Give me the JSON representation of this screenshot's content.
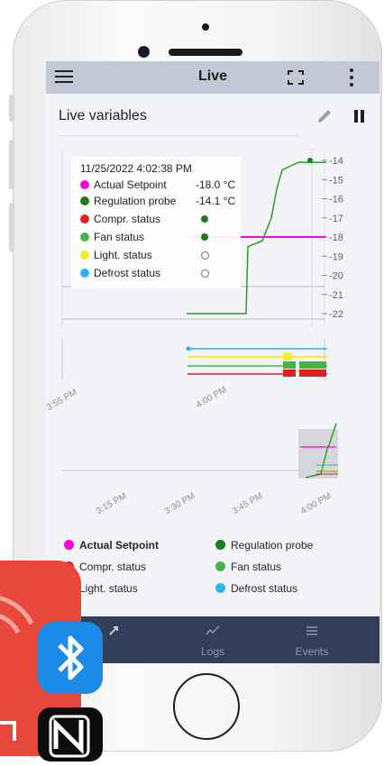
{
  "app": {
    "title": "Live",
    "section_title": "Live variables"
  },
  "tooltip": {
    "time": "11/25/2022 4:02:38 PM",
    "rows": [
      {
        "label": "Actual Setpoint",
        "value": "-18.0 °C",
        "color": "#ff00e0"
      },
      {
        "label": "Regulation probe",
        "value": "-14.1 °C",
        "color": "#1b7d1b"
      },
      {
        "label": "Compr. status",
        "value": "",
        "color": "#e02020"
      },
      {
        "label": "Fan status",
        "value": "",
        "color": "#45b54b"
      },
      {
        "label": "Light. status",
        "value": "",
        "color": "#f2ee2a"
      },
      {
        "label": "Defrost status",
        "value": "",
        "color": "#29b6f0"
      }
    ]
  },
  "chart_data": {
    "type": "line",
    "y_ticks": [
      "-14",
      "-15",
      "-16",
      "-17",
      "-18",
      "-19",
      "-20",
      "-21",
      "-22"
    ],
    "ylim": [
      -22,
      -14
    ],
    "detail_x_ticks": [
      "3:55 PM",
      "4:00 PM"
    ],
    "overview_x_ticks": [
      "3:15 PM",
      "3:30 PM",
      "3:45 PM",
      "4:00 PM"
    ],
    "series": [
      {
        "name": "Actual Setpoint",
        "values": [
          -18,
          -18,
          -18
        ]
      },
      {
        "name": "Regulation probe",
        "values": [
          -22,
          -22,
          -22,
          -18.5,
          -18.2,
          -17,
          -15.5,
          -14.5,
          -14.1,
          -14.1
        ]
      }
    ]
  },
  "legend": [
    {
      "label": "Actual Setpoint",
      "color": "#ff00e0",
      "bold": true
    },
    {
      "label": "Regulation probe",
      "color": "#1b7d1b"
    },
    {
      "label": "Compr. status",
      "color": "#e02020"
    },
    {
      "label": "Fan status",
      "color": "#45b54b"
    },
    {
      "label": "Light. status",
      "color": "#f2ee2a"
    },
    {
      "label": "Defrost status",
      "color": "#29b6f0"
    }
  ],
  "bottom_nav": [
    {
      "label": "",
      "icon": "live-icon"
    },
    {
      "label": "Logs",
      "icon": "logs-icon"
    },
    {
      "label": "Events",
      "icon": "events-icon"
    }
  ]
}
